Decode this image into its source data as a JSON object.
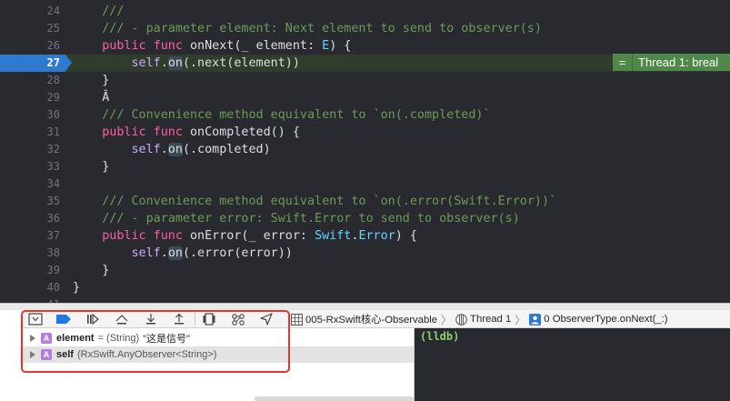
{
  "editor": {
    "lines": [
      {
        "num": "24",
        "segments": [
          {
            "t": "    ",
            "c": ""
          },
          {
            "t": "///",
            "c": "c"
          }
        ]
      },
      {
        "num": "25",
        "segments": [
          {
            "t": "    ",
            "c": ""
          },
          {
            "t": "/// - parameter element: Next element to send to observer(s)",
            "c": "c"
          }
        ]
      },
      {
        "num": "26",
        "segments": [
          {
            "t": "    ",
            "c": ""
          },
          {
            "t": "public",
            "c": "k"
          },
          {
            "t": " ",
            "c": ""
          },
          {
            "t": "func",
            "c": "k"
          },
          {
            "t": " onNext(_ element: ",
            "c": ""
          },
          {
            "t": "E",
            "c": "t"
          },
          {
            "t": ") {",
            "c": ""
          }
        ]
      },
      {
        "num": "27",
        "current": true,
        "segments": [
          {
            "t": "        ",
            "c": ""
          },
          {
            "t": "self",
            "c": "s"
          },
          {
            "t": ".",
            "c": ""
          },
          {
            "t": "on",
            "c": "h"
          },
          {
            "t": "(.next(element))",
            "c": ""
          }
        ]
      },
      {
        "num": "28",
        "segments": [
          {
            "t": "    }",
            "c": ""
          }
        ]
      },
      {
        "num": "29",
        "segments": [
          {
            "t": "    Â",
            "c": ""
          }
        ]
      },
      {
        "num": "30",
        "segments": [
          {
            "t": "    ",
            "c": ""
          },
          {
            "t": "/// Convenience method equivalent to `on(.completed)`",
            "c": "c"
          }
        ]
      },
      {
        "num": "31",
        "segments": [
          {
            "t": "    ",
            "c": ""
          },
          {
            "t": "public",
            "c": "k"
          },
          {
            "t": " ",
            "c": ""
          },
          {
            "t": "func",
            "c": "k"
          },
          {
            "t": " onCompleted() {",
            "c": ""
          }
        ]
      },
      {
        "num": "32",
        "segments": [
          {
            "t": "        ",
            "c": ""
          },
          {
            "t": "self",
            "c": "s"
          },
          {
            "t": ".",
            "c": ""
          },
          {
            "t": "on",
            "c": "h"
          },
          {
            "t": "(.completed)",
            "c": ""
          }
        ]
      },
      {
        "num": "33",
        "segments": [
          {
            "t": "    }",
            "c": ""
          }
        ]
      },
      {
        "num": "34",
        "segments": [
          {
            "t": "",
            "c": ""
          }
        ]
      },
      {
        "num": "35",
        "segments": [
          {
            "t": "    ",
            "c": ""
          },
          {
            "t": "/// Convenience method equivalent to `on(.error(Swift.Error))`",
            "c": "c"
          }
        ]
      },
      {
        "num": "36",
        "segments": [
          {
            "t": "    ",
            "c": ""
          },
          {
            "t": "/// - parameter error: Swift.Error to send to observer(s)",
            "c": "c"
          }
        ]
      },
      {
        "num": "37",
        "segments": [
          {
            "t": "    ",
            "c": ""
          },
          {
            "t": "public",
            "c": "k"
          },
          {
            "t": " ",
            "c": ""
          },
          {
            "t": "func",
            "c": "k"
          },
          {
            "t": " onError(_ error: ",
            "c": ""
          },
          {
            "t": "Swift",
            "c": "t"
          },
          {
            "t": ".",
            "c": ""
          },
          {
            "t": "Error",
            "c": "t"
          },
          {
            "t": ") {",
            "c": ""
          }
        ]
      },
      {
        "num": "38",
        "segments": [
          {
            "t": "        ",
            "c": ""
          },
          {
            "t": "self",
            "c": "s"
          },
          {
            "t": ".",
            "c": ""
          },
          {
            "t": "on",
            "c": "h"
          },
          {
            "t": "(.error(error))",
            "c": ""
          }
        ]
      },
      {
        "num": "39",
        "segments": [
          {
            "t": "    }",
            "c": ""
          }
        ]
      },
      {
        "num": "40",
        "segments": [
          {
            "t": "}",
            "c": ""
          }
        ]
      },
      {
        "num": "41",
        "segments": [
          {
            "t": "",
            "c": ""
          }
        ]
      }
    ],
    "thread_badge": {
      "eq": "=",
      "label": "Thread 1: breal"
    }
  },
  "debug_toolbar": {
    "buttons": [
      {
        "name": "hide-debug-area-button",
        "icon": "panel-hide-icon"
      },
      {
        "name": "breakpoints-toggle-button",
        "icon": "breakpoint-icon"
      },
      {
        "name": "continue-button",
        "icon": "continue-icon"
      },
      {
        "name": "step-over-button",
        "icon": "step-over-icon"
      },
      {
        "name": "step-into-button",
        "icon": "step-into-icon"
      },
      {
        "name": "step-out-button",
        "icon": "step-out-icon"
      },
      {
        "name": "view-debugger-button",
        "icon": "view-hierarchy-icon"
      },
      {
        "name": "memory-graph-button",
        "icon": "memory-graph-icon"
      },
      {
        "name": "simulate-location-button",
        "icon": "location-arrow-icon"
      }
    ],
    "breadcrumb": {
      "target": "005-RxSwift核心-Observable",
      "thread": "Thread 1",
      "frame": "0 ObserverType.onNext(_:)"
    }
  },
  "variables": [
    {
      "name": "element",
      "type": "= (String)",
      "value": "\"这是信号\"",
      "badge": "A"
    },
    {
      "name": "self",
      "type": "(RxSwift.AnyObserver<String>)",
      "value": "",
      "badge": "A"
    }
  ],
  "console": {
    "prompt": "(lldb)"
  },
  "colors": {
    "editor_bg": "#292a30",
    "current_line": "#303c2c",
    "badge_green": "#4f8848",
    "line_marker": "#2f7ad0",
    "highlight_box": "#e8362b"
  }
}
